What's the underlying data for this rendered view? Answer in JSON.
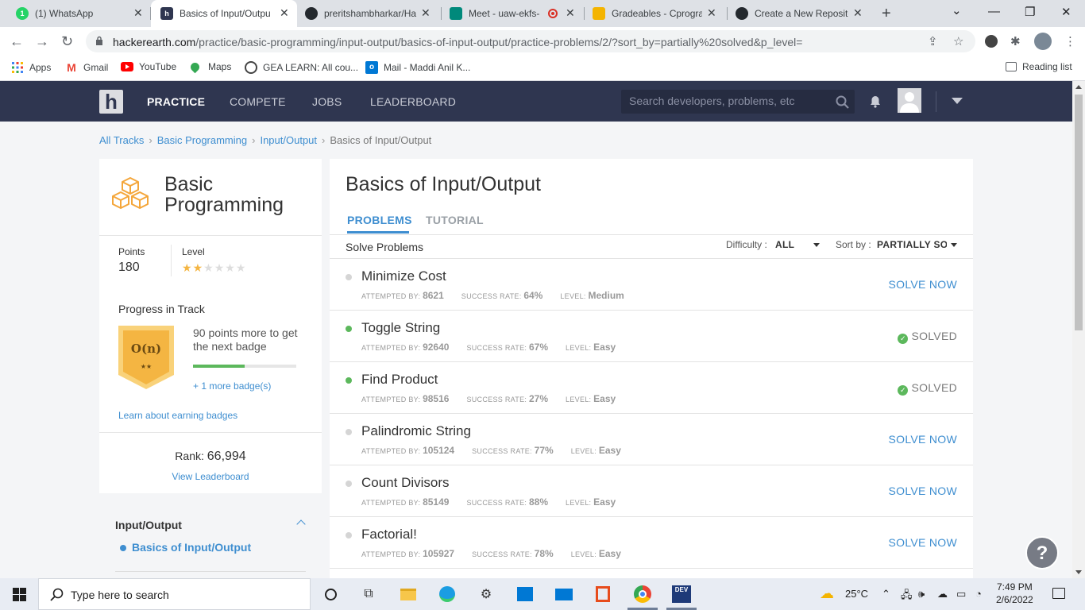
{
  "browser": {
    "tabs": [
      {
        "label": "(1) WhatsApp",
        "color": "#25d366",
        "glyph": "1"
      },
      {
        "label": "Basics of Input/Output",
        "color": "#2f3650",
        "glyph": "h"
      },
      {
        "label": "preritshambharkar/Ha",
        "color": "#24292e",
        "glyph": "⬤"
      },
      {
        "label": "Meet - uaw-ekfs-",
        "color": "#00897b",
        "glyph": "▶"
      },
      {
        "label": "Gradeables - Cprogran",
        "color": "#f4b400",
        "glyph": "✋"
      },
      {
        "label": "Create a New Reposito",
        "color": "#24292e",
        "glyph": "⬤"
      }
    ],
    "url_host": "hackerearth.com",
    "url_path": "/practice/basic-programming/input-output/basics-of-input-output/practice-problems/2/?sort_by=partially%20solved&p_level=",
    "bookmarks": [
      {
        "label": "Apps",
        "icon": "apps-grid-icon",
        "color": "#4285f4"
      },
      {
        "label": "Gmail",
        "icon": "gmail-icon",
        "color": "#ea4335"
      },
      {
        "label": "YouTube",
        "icon": "youtube-icon",
        "color": "#ff0000"
      },
      {
        "label": "Maps",
        "icon": "maps-pin-icon",
        "color": "#34a853"
      },
      {
        "label": "GEA LEARN: All cou...",
        "icon": "gea-icon",
        "color": "#444444"
      },
      {
        "label": "Mail - Maddi Anil K...",
        "icon": "outlook-icon",
        "color": "#0078d4"
      }
    ],
    "reading_list": "Reading list"
  },
  "header": {
    "logo": "h",
    "nav": [
      "PRACTICE",
      "COMPETE",
      "JOBS",
      "LEADERBOARD"
    ],
    "search_placeholder": "Search developers, problems, etc"
  },
  "breadcrumb": [
    "All Tracks",
    "Basic Programming",
    "Input/Output",
    "Basics of Input/Output"
  ],
  "track": {
    "title": "Basic Programming",
    "points_label": "Points",
    "points": "180",
    "level_label": "Level",
    "level_stars": 2,
    "level_max": 6,
    "progress_title": "Progress in Track",
    "badge_text": "O(n)",
    "badge_stars": "★★",
    "next_badge_text": "90 points more to get the next badge",
    "progress_fraction": 0.5,
    "more_badges": "+ 1 more badge(s)",
    "learn_link": "Learn about earning badges",
    "rank_label": "Rank:",
    "rank": "66,994",
    "leaderboard_link": "View Leaderboard"
  },
  "leftnav": {
    "section": "Input/Output",
    "item": "Basics of Input/Output"
  },
  "main": {
    "title": "Basics of Input/Output",
    "tabs": [
      "PROBLEMS",
      "TUTORIAL"
    ],
    "solve_label": "Solve Problems",
    "difficulty_label": "Difficulty :",
    "difficulty_value": "ALL",
    "sort_label": "Sort by :",
    "sort_value": "PARTIALLY SOL",
    "meta_attempted": "ATTEMPTED BY:",
    "meta_success": "SUCCESS RATE:",
    "meta_level": "LEVEL:",
    "problems": [
      {
        "name": "Minimize Cost",
        "attempted": "8621",
        "success": "64%",
        "level": "Medium",
        "action": "SOLVE NOW",
        "solved": false
      },
      {
        "name": "Toggle String",
        "attempted": "92640",
        "success": "67%",
        "level": "Easy",
        "action": "SOLVED",
        "solved": true
      },
      {
        "name": "Find Product",
        "attempted": "98516",
        "success": "27%",
        "level": "Easy",
        "action": "SOLVED",
        "solved": true
      },
      {
        "name": "Palindromic String",
        "attempted": "105124",
        "success": "77%",
        "level": "Easy",
        "action": "SOLVE NOW",
        "solved": false
      },
      {
        "name": "Count Divisors",
        "attempted": "85149",
        "success": "88%",
        "level": "Easy",
        "action": "SOLVE NOW",
        "solved": false
      },
      {
        "name": "Factorial!",
        "attempted": "105927",
        "success": "78%",
        "level": "Easy",
        "action": "SOLVE NOW",
        "solved": false
      }
    ],
    "help": "?"
  },
  "taskbar": {
    "search_text": "Type here to search",
    "temperature": "25°C",
    "time": "7:49 PM",
    "date": "2/6/2022"
  },
  "colors": {
    "accent": "#3e8ed0",
    "header_bg": "#2f3650",
    "solved_green": "#5cb85c",
    "star": "#f4b542"
  }
}
